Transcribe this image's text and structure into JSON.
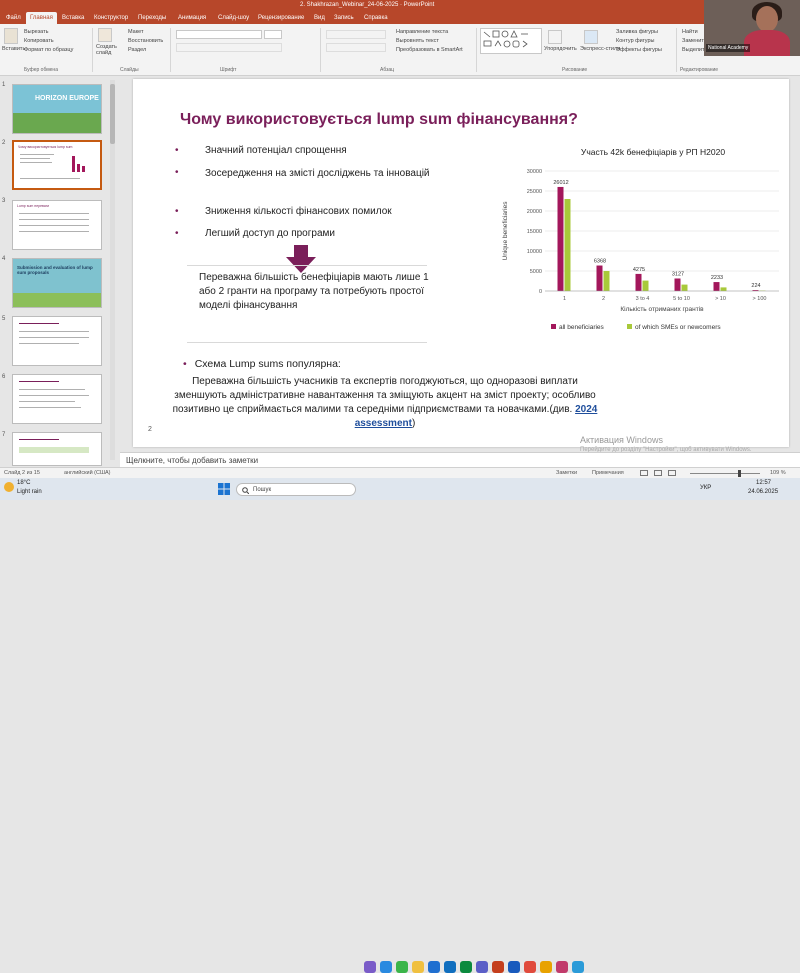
{
  "window": {
    "title": "2. Shakhrazan_Webinar_24-06-2025 · PowerPoint"
  },
  "ribbon_tabs": [
    "Файл",
    "Главная",
    "Вставка",
    "Конструктор",
    "Переходы",
    "Анимация",
    "Слайд-шоу",
    "Рецензирование",
    "Вид",
    "Запись",
    "Справка"
  ],
  "ribbon": {
    "paste": "Вставить",
    "cut": "Вырезать",
    "copy": "Копировать",
    "format_painter": "Формат по образцу",
    "clipboard_group": "Буфер обмена",
    "new_slide": "Создать слайд",
    "layout": "Макет",
    "reset": "Восстановить",
    "section": "Раздел",
    "slides_group": "Слайды",
    "font_group": "Шрифт",
    "paragraph_group": "Абзац",
    "text_dir": "Направление текста",
    "align_text": "Выровнять текст",
    "smartart": "Преобразовать в SmartArt",
    "arrange": "Упорядочить",
    "quick_styles": "Экспресс-стили",
    "shape_fill": "Заливка фигуры",
    "shape_outline": "Контур фигуры",
    "shape_effects": "Эффекты фигуры",
    "drawing_group": "Рисование",
    "find": "Найти",
    "replace": "Заменить",
    "select": "Выделить",
    "editing_group": "Редактирование"
  },
  "video": {
    "badge": "National Academy"
  },
  "thumbnails": [
    {
      "num": "1",
      "title": "HORIZON EUROPE"
    },
    {
      "num": "2",
      "title": "Чому використовується lump sum"
    },
    {
      "num": "3",
      "title": "Lump sum переваги"
    },
    {
      "num": "4",
      "title": "Submission and evaluation of lump sum proposals"
    },
    {
      "num": "5",
      "title": ""
    },
    {
      "num": "6",
      "title": ""
    },
    {
      "num": "7",
      "title": ""
    }
  ],
  "slide": {
    "title": "Чому використовується lump sum фінансування?",
    "bullets": [
      "Значний потенціал спрощення",
      "Зосередження на змісті досліджень та інновацій",
      "Зниження кількості фінансових помилок",
      "Легший доступ до програми"
    ],
    "callout": "Переважна більшість бенефіціарів мають лише 1 або 2 гранти на програму та потребують простої моделі фінансування",
    "lump_heading": "Схема Lump sums популярна:",
    "lump_body": "Переважна більшість учасників та експертів погоджуються, що одноразові виплати зменшують адміністративне навантаження та зміщують акцент на зміст проекту; особливо позитивно це сприймається малими та середніми підприємствами та новачками.(див.",
    "lump_link": "2024 assessment",
    "lump_close": ")",
    "page_number": "2",
    "watermark": "Активация Windows",
    "watermark_sub": "Перейдите до розділу \"Настройки\", щоб активувати Windows."
  },
  "chart_data": {
    "type": "bar",
    "title": "Участь 42k бенефіціарів у РП H2020",
    "xlabel": "Кількість отриманих грантів",
    "ylabel": "Unique beneficiaries",
    "categories": [
      "1",
      "2",
      "3 to 4",
      "5 to 10",
      "> 10",
      "> 100"
    ],
    "series": [
      {
        "name": "all beneficiaries",
        "color": "#a3175b",
        "values": [
          26012,
          6368,
          4275,
          3127,
          2233,
          224
        ]
      },
      {
        "name": "of which SMEs or newcomers",
        "color": "#a8c93a",
        "values": [
          23000,
          5000,
          2600,
          1600,
          900,
          100
        ]
      }
    ],
    "data_labels": [
      "26012",
      "6368",
      "4275",
      "3127",
      "2233",
      "224"
    ],
    "ylim": [
      0,
      30000
    ],
    "yticks": [
      "0",
      "5000",
      "10000",
      "15000",
      "20000",
      "25000",
      "30000"
    ],
    "grid": true,
    "legend": "bottom"
  },
  "notes": {
    "placeholder": "Щелкните, чтобы добавить заметки"
  },
  "status": {
    "slide": "Слайд 2 из 15",
    "language": "английский (США)",
    "notes_btn": "Заметки",
    "comments_btn": "Примечания",
    "zoom": "109 %"
  },
  "taskbar": {
    "weather_temp": "18°C",
    "weather_desc": "Light rain",
    "search": "Пошук",
    "lang": "УКР",
    "time": "12:57",
    "date": "24.06.2025"
  }
}
